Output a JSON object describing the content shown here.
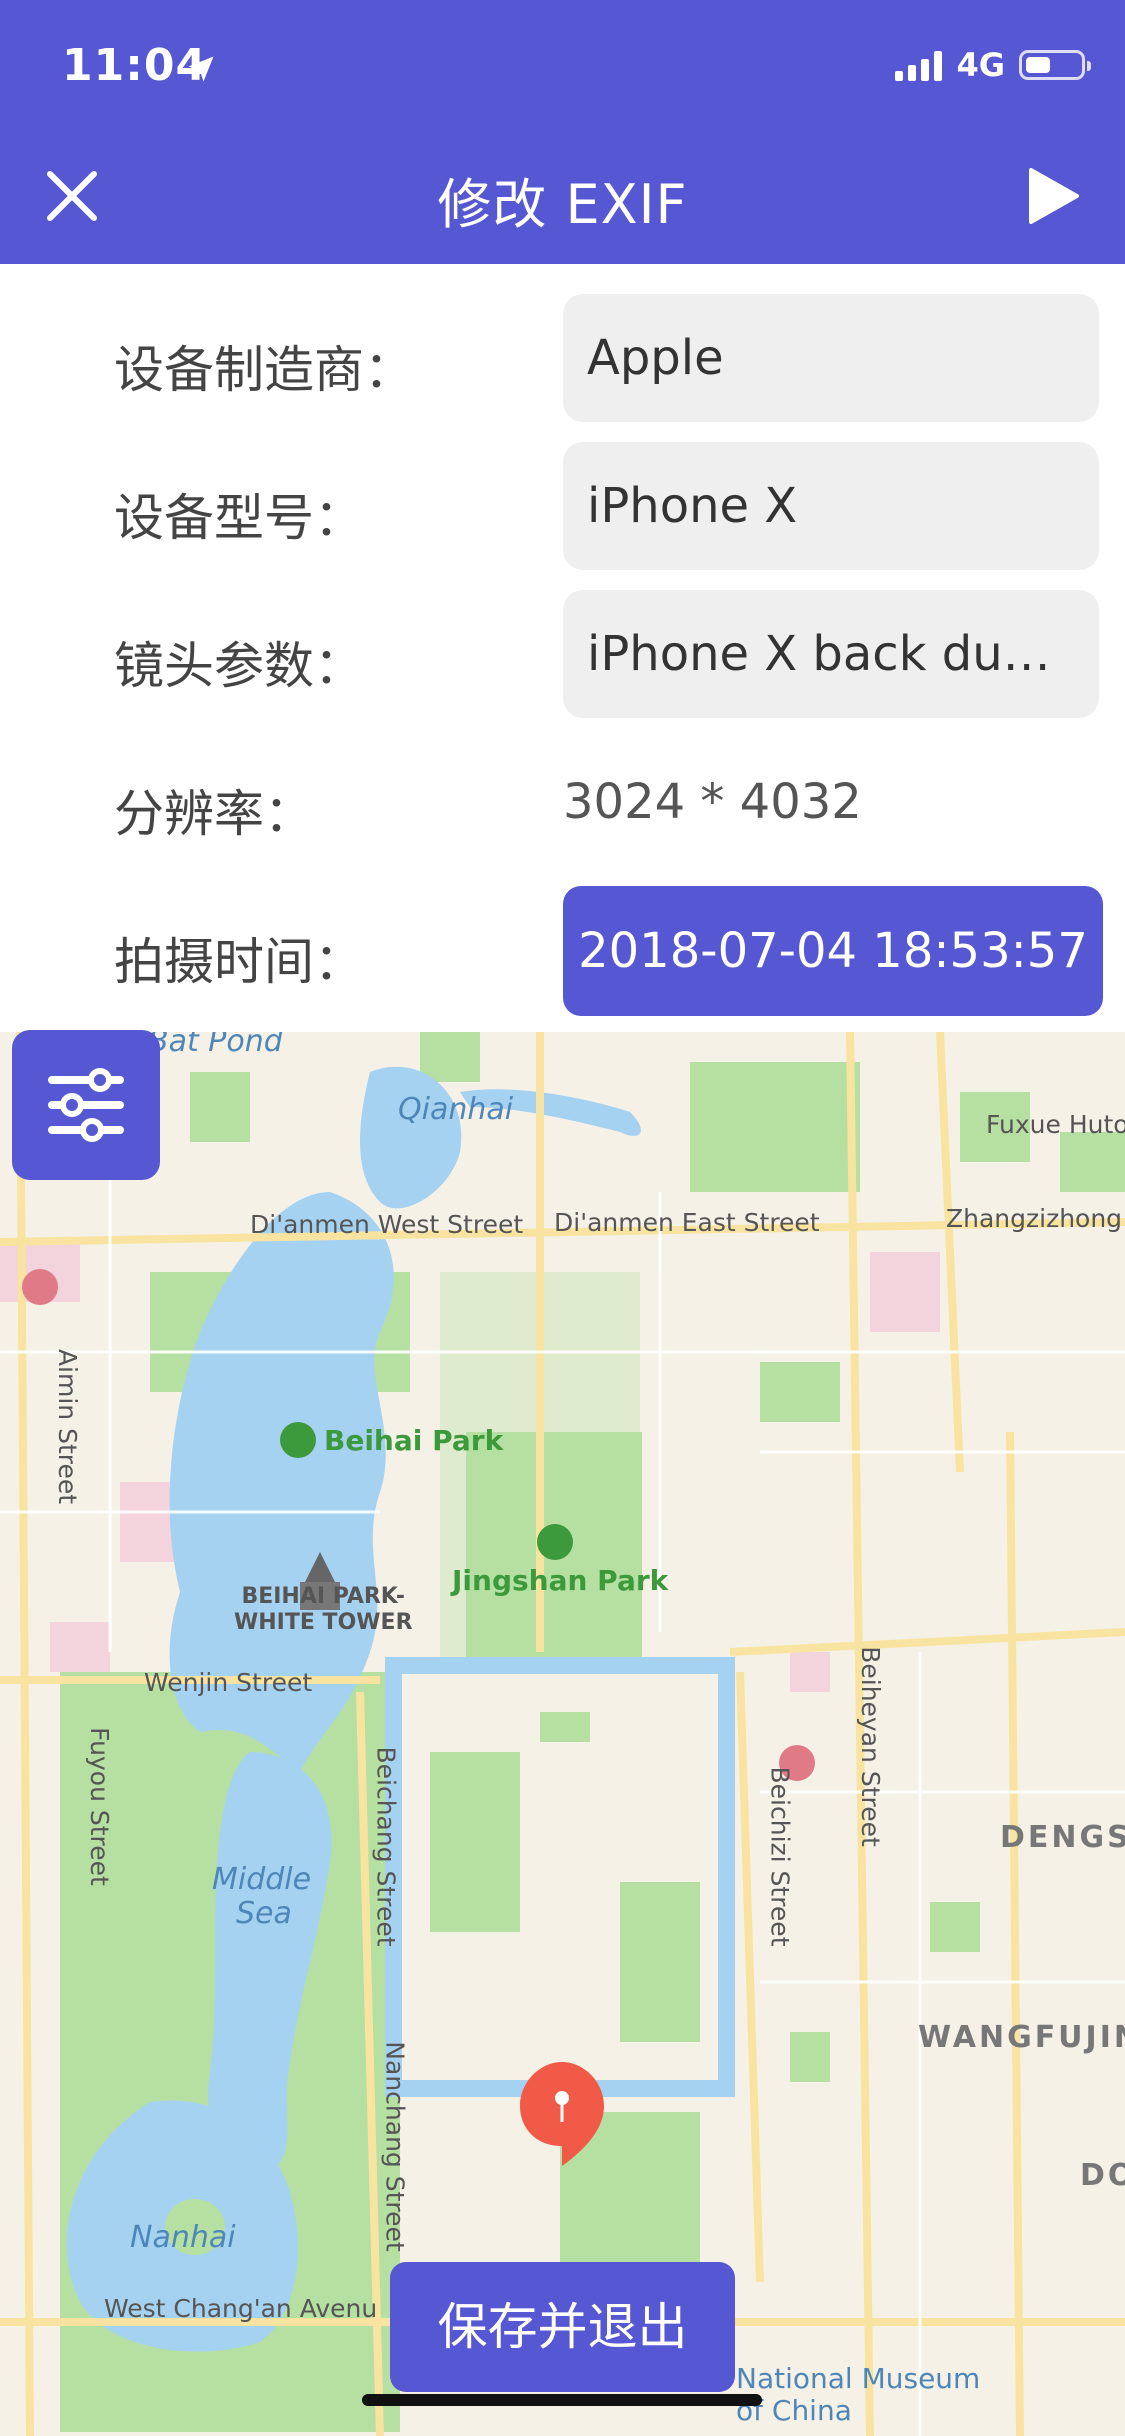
{
  "status_bar": {
    "time": "11:04",
    "network": "4G"
  },
  "header": {
    "title": "修改 EXIF"
  },
  "form": {
    "rows": [
      {
        "label": "设备制造商：",
        "value": "Apple"
      },
      {
        "label": "设备型号：",
        "value": "iPhone X"
      },
      {
        "label": "镜头参数：",
        "value": "iPhone X back dual camera"
      },
      {
        "label": "分辨率：",
        "value": "3024 * 4032"
      },
      {
        "label": "拍摄时间：",
        "value": "2018-07-04 18:53:57"
      }
    ]
  },
  "map": {
    "labels": {
      "bat_pond": "Bat Pond",
      "qianhai": "Qianhai",
      "fuxue": "Fuxue Huto",
      "dianmen_west": "Di'anmen West Street",
      "dianmen_east": "Di'anmen East Street",
      "zhangzizhong": "Zhangzizhong",
      "aimin": "Aimin Street",
      "beihai_park": "Beihai Park",
      "jingshan_park": "Jingshan Park",
      "white_tower_1": "BEIHAI PARK-",
      "white_tower_2": "WHITE TOWER",
      "beiheyan": "Beiheyan Street",
      "fuyou": "Fuyou Street",
      "wenjin": "Wenjin Street",
      "beichang": "Beichang Street",
      "beichizi": "Beichizi Street",
      "dengs": "DENGS",
      "middle_sea_1": "Middle",
      "middle_sea_2": "Sea",
      "wangfujing": "WANGFUJIN",
      "nanchang": "Nanchang Street",
      "do": "DO",
      "nanhai": "Nanhai",
      "west_changan": "West Chang'an Avenu",
      "museum_1": "National Museum",
      "museum_2": "of China"
    }
  },
  "buttons": {
    "save": "保存并退出"
  },
  "colors": {
    "accent": "#5557d3",
    "water": "#a6d2f2",
    "park": "#b5e0a1",
    "pin": "#f05a47"
  }
}
